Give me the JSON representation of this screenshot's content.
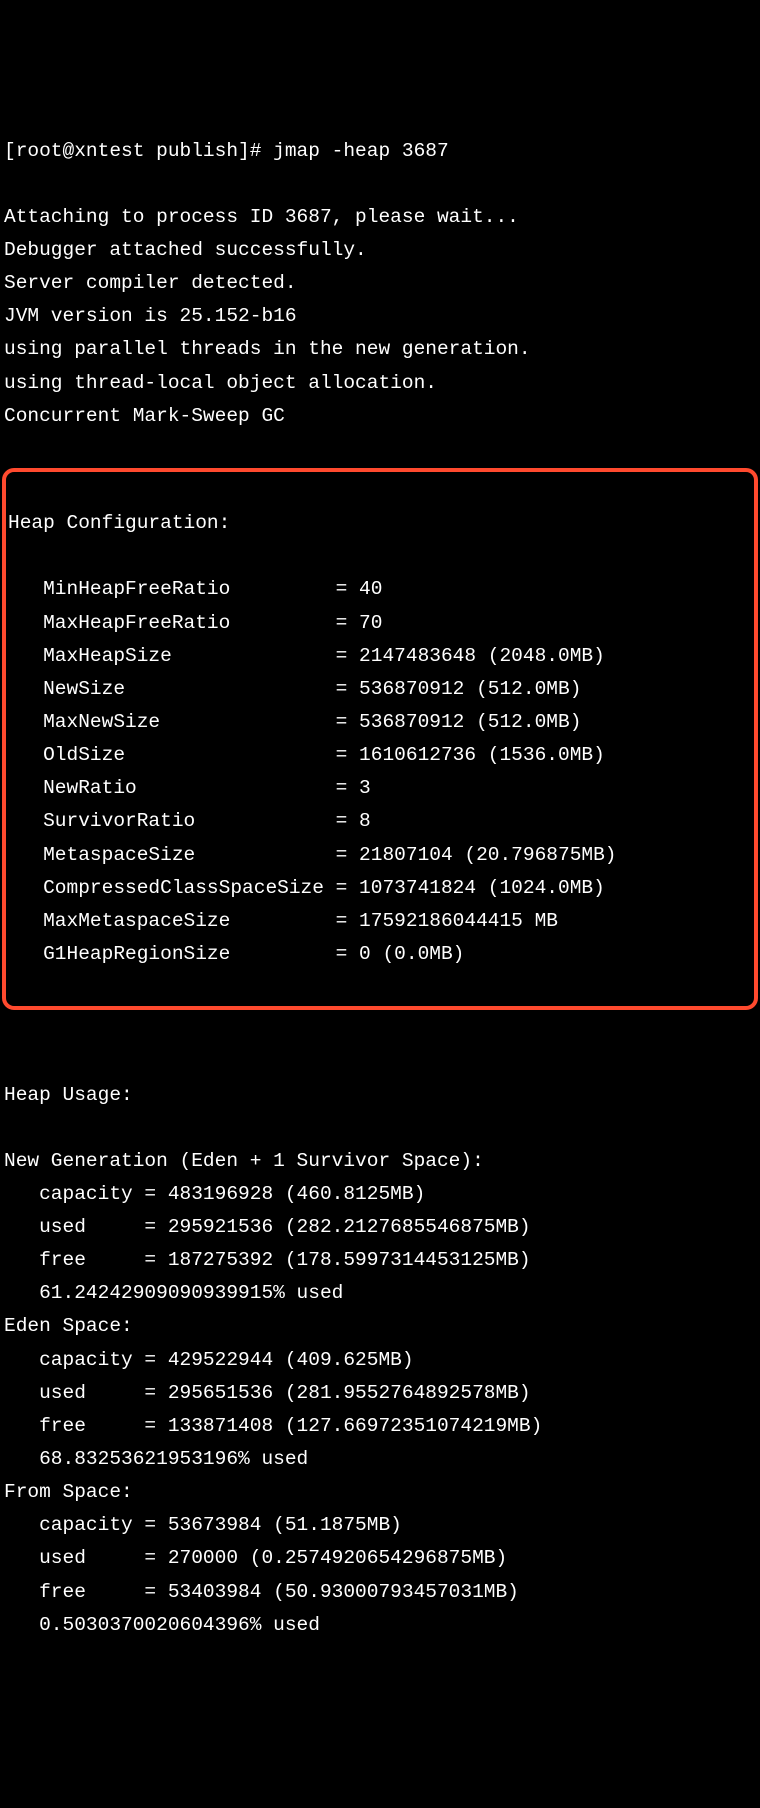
{
  "header": {
    "prompt_line": "[root@xntest publish]# jmap -heap 3687",
    "lines": [
      "Attaching to process ID 3687, please wait...",
      "Debugger attached successfully.",
      "Server compiler detected.",
      "JVM version is 25.152-b16",
      "",
      "using parallel threads in the new generation.",
      "using thread-local object allocation.",
      "Concurrent Mark-Sweep GC",
      ""
    ]
  },
  "heap_config": {
    "title": "Heap Configuration:",
    "rows": [
      {
        "name": "MinHeapFreeRatio",
        "value": "40"
      },
      {
        "name": "MaxHeapFreeRatio",
        "value": "70"
      },
      {
        "name": "MaxHeapSize",
        "value": "2147483648 (2048.0MB)"
      },
      {
        "name": "NewSize",
        "value": "536870912 (512.0MB)"
      },
      {
        "name": "MaxNewSize",
        "value": "536870912 (512.0MB)"
      },
      {
        "name": "OldSize",
        "value": "1610612736 (1536.0MB)"
      },
      {
        "name": "NewRatio",
        "value": "3"
      },
      {
        "name": "SurvivorRatio",
        "value": "8"
      },
      {
        "name": "MetaspaceSize",
        "value": "21807104 (20.796875MB)"
      },
      {
        "name": "CompressedClassSpaceSize",
        "value": "1073741824 (1024.0MB)"
      },
      {
        "name": "MaxMetaspaceSize",
        "value": "17592186044415 MB"
      },
      {
        "name": "G1HeapRegionSize",
        "value": "0 (0.0MB)"
      }
    ]
  },
  "usage": {
    "title_blank": "",
    "title": "Heap Usage:",
    "sections": [
      {
        "header": "New Generation (Eden + 1 Survivor Space):",
        "rows": [
          {
            "name": "capacity",
            "value": "483196928 (460.8125MB)"
          },
          {
            "name": "used",
            "value": "295921536 (282.2127685546875MB)"
          },
          {
            "name": "free",
            "value": "187275392 (178.5997314453125MB)"
          }
        ],
        "percent": "61.24242909090939915% used"
      },
      {
        "header": "Eden Space:",
        "rows": [
          {
            "name": "capacity",
            "value": "429522944 (409.625MB)"
          },
          {
            "name": "used",
            "value": "295651536 (281.9552764892578MB)"
          },
          {
            "name": "free",
            "value": "133871408 (127.66972351074219MB)"
          }
        ],
        "percent": "68.83253621953196% used"
      },
      {
        "header": "From Space:",
        "rows": [
          {
            "name": "capacity",
            "value": "53673984 (51.1875MB)"
          },
          {
            "name": "used",
            "value": "270000 (0.2574920654296875MB)"
          },
          {
            "name": "free",
            "value": "53403984 (50.93000793457031MB)"
          }
        ],
        "percent": "0.5030370020604396% used"
      }
    ]
  }
}
